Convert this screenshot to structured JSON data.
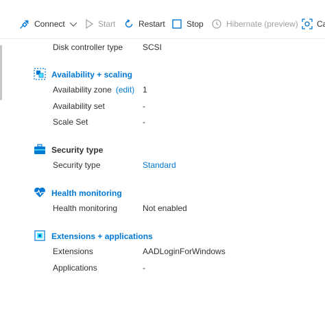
{
  "toolbar": {
    "connect": "Connect",
    "start": "Start",
    "restart": "Restart",
    "stop": "Stop",
    "hibernate": "Hibernate (preview)",
    "capture": "Ca"
  },
  "disk": {
    "controller_label": "Disk controller type",
    "controller_value": "SCSI"
  },
  "availability": {
    "title": "Availability + scaling",
    "zone_label": "Availability zone",
    "zone_edit": "(edit)",
    "zone_value": "1",
    "set_label": "Availability set",
    "set_value": "-",
    "scale_label": "Scale Set",
    "scale_value": "-"
  },
  "security": {
    "title": "Security type",
    "type_label": "Security type",
    "type_value": "Standard"
  },
  "health": {
    "title": "Health monitoring",
    "label": "Health monitoring",
    "value": "Not enabled"
  },
  "extensions": {
    "title": "Extensions + applications",
    "ext_label": "Extensions",
    "ext_value": "AADLoginForWindows",
    "apps_label": "Applications",
    "apps_value": "-"
  },
  "colors": {
    "link": "#0078d4",
    "text": "#323130",
    "disabled": "#a19f9d"
  }
}
